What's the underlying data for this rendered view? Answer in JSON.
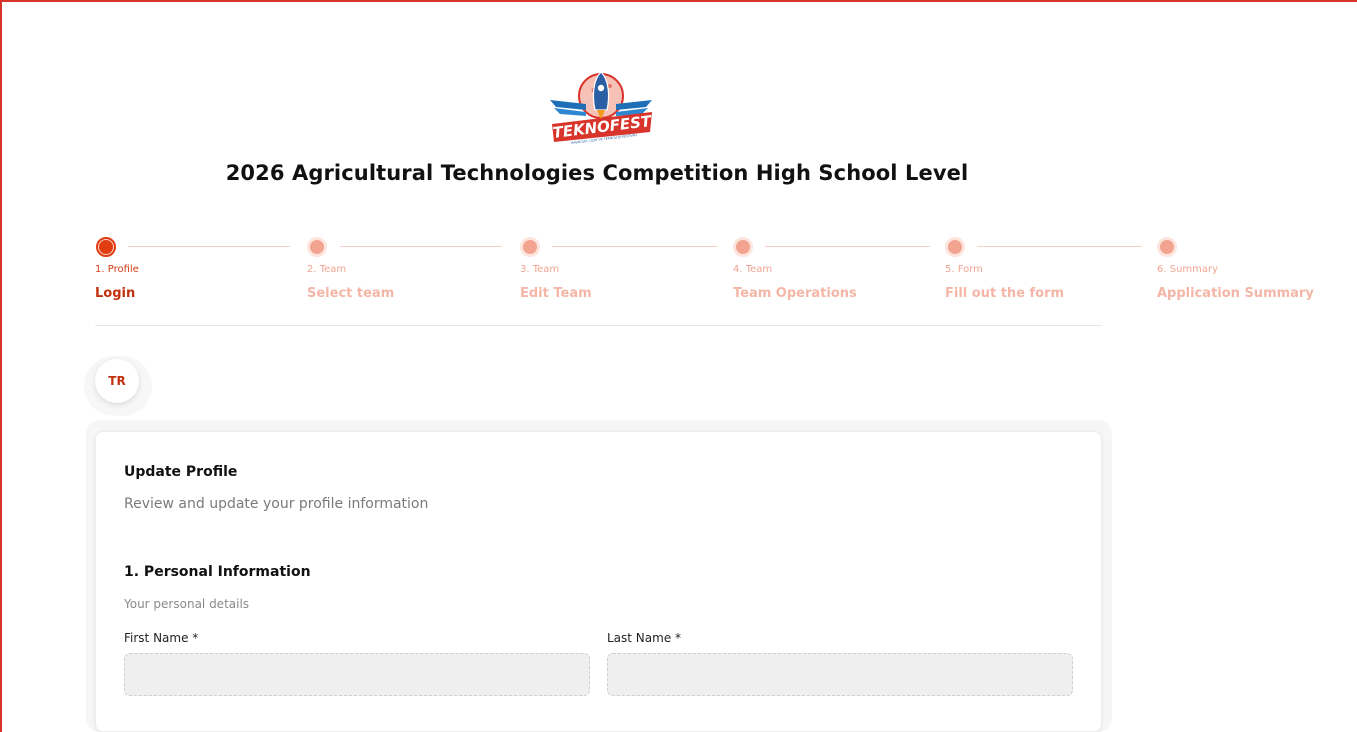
{
  "header": {
    "logo_text": "TEKNOFEST",
    "logo_tagline": "HAVACILIK, UZAY VE TEKNOLOJİ FESTİVALİ",
    "title": "2026 Agricultural Technologies Competition High School Level"
  },
  "stepper": {
    "steps": [
      {
        "num": "1. Profile",
        "label": "Login"
      },
      {
        "num": "2. Team",
        "label": "Select team"
      },
      {
        "num": "3. Team",
        "label": "Edit Team"
      },
      {
        "num": "4. Team",
        "label": "Team Operations"
      },
      {
        "num": "5. Form",
        "label": "Fill out the form"
      },
      {
        "num": "6. Summary",
        "label": "Application Summary"
      }
    ],
    "active_index": 0
  },
  "language": {
    "code": "TR"
  },
  "card": {
    "title": "Update Profile",
    "subtitle": "Review and update your profile information",
    "section": {
      "title": "1. Personal Information",
      "subtitle": "Your personal details",
      "fields": [
        {
          "label": "First Name *",
          "value": ""
        },
        {
          "label": "Last Name *",
          "value": ""
        }
      ]
    }
  },
  "colors": {
    "accent": "#e23d12",
    "accent_light": "#f2a490",
    "frame": "#d9342b"
  }
}
